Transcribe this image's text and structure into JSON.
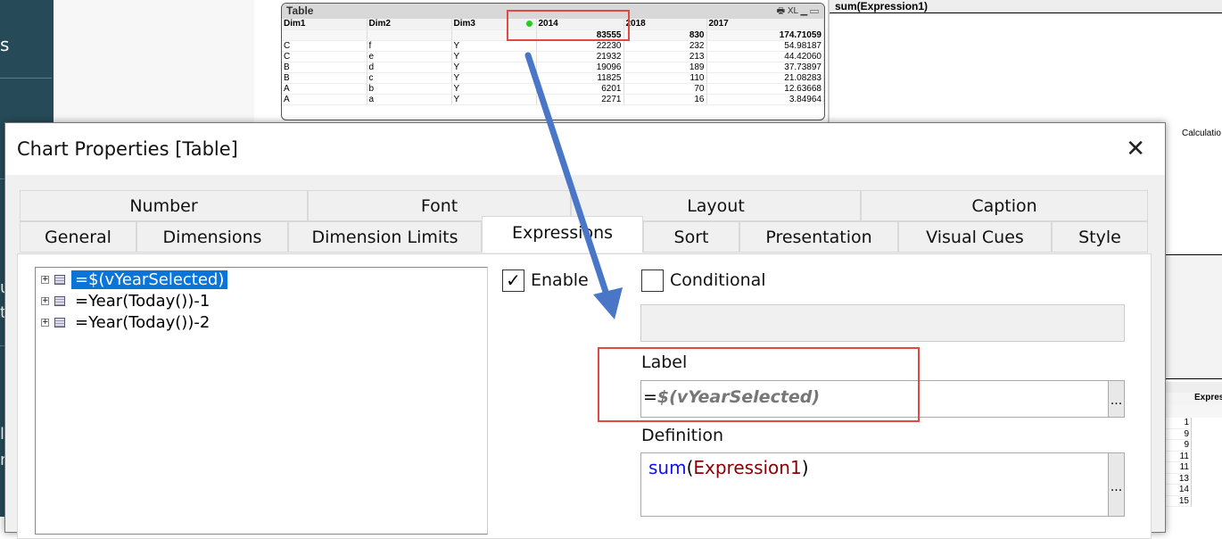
{
  "sidebar": {
    "fragments": [
      "s",
      "u",
      "t",
      "l",
      "n"
    ]
  },
  "table_object": {
    "title": "Table",
    "caption_icons": "🖶 XL ▁ ▭",
    "columns": [
      "Dim1",
      "Dim2",
      "Dim3",
      "2014",
      "2018",
      "2017"
    ],
    "totals": [
      "",
      "",
      "",
      "83555",
      "830",
      "174.71059"
    ],
    "rows": [
      [
        "C",
        "f",
        "Y",
        "22230",
        "232",
        "54.98187"
      ],
      [
        "C",
        "e",
        "Y",
        "21932",
        "213",
        "44.42060"
      ],
      [
        "B",
        "d",
        "Y",
        "19096",
        "189",
        "37.73897"
      ],
      [
        "B",
        "c",
        "Y",
        "11825",
        "110",
        "21.08283"
      ],
      [
        "A",
        "b",
        "Y",
        "6201",
        "70",
        "12.63668"
      ],
      [
        "A",
        "a",
        "Y",
        "2271",
        "16",
        "3.84964"
      ]
    ]
  },
  "right_panel": {
    "title": "sum(Expression1)",
    "calc_text": "Calculatio",
    "table_header": "Expres",
    "values": [
      "1",
      "9",
      "9",
      "11",
      "11",
      "13",
      "14",
      "15"
    ]
  },
  "dialog": {
    "title": "Chart Properties [Table]",
    "tabs_row1": [
      "Number",
      "Font",
      "Layout",
      "Caption"
    ],
    "tabs_row2": [
      "General",
      "Dimensions",
      "Dimension Limits",
      "Expressions",
      "Sort",
      "Presentation",
      "Visual Cues",
      "Style"
    ],
    "active_tab": "Expressions",
    "expressions": [
      "=$(vYearSelected)",
      "=Year(Today())-1",
      "=Year(Today())-2"
    ],
    "enable_label": "Enable",
    "enable_checked": true,
    "conditional_label": "Conditional",
    "conditional_checked": false,
    "label_heading": "Label",
    "label_value_prefix": "=",
    "label_value": "$(vYearSelected)",
    "definition_heading": "Definition",
    "definition_func": "sum",
    "definition_open": "(",
    "definition_arg": "Expression1",
    "definition_close": ")",
    "ellipsis": "..."
  },
  "colors": {
    "highlight_box": "#e04a42",
    "arrow": "#4a76c8",
    "sidebar": "#264a58",
    "selection": "#0a74d8"
  }
}
